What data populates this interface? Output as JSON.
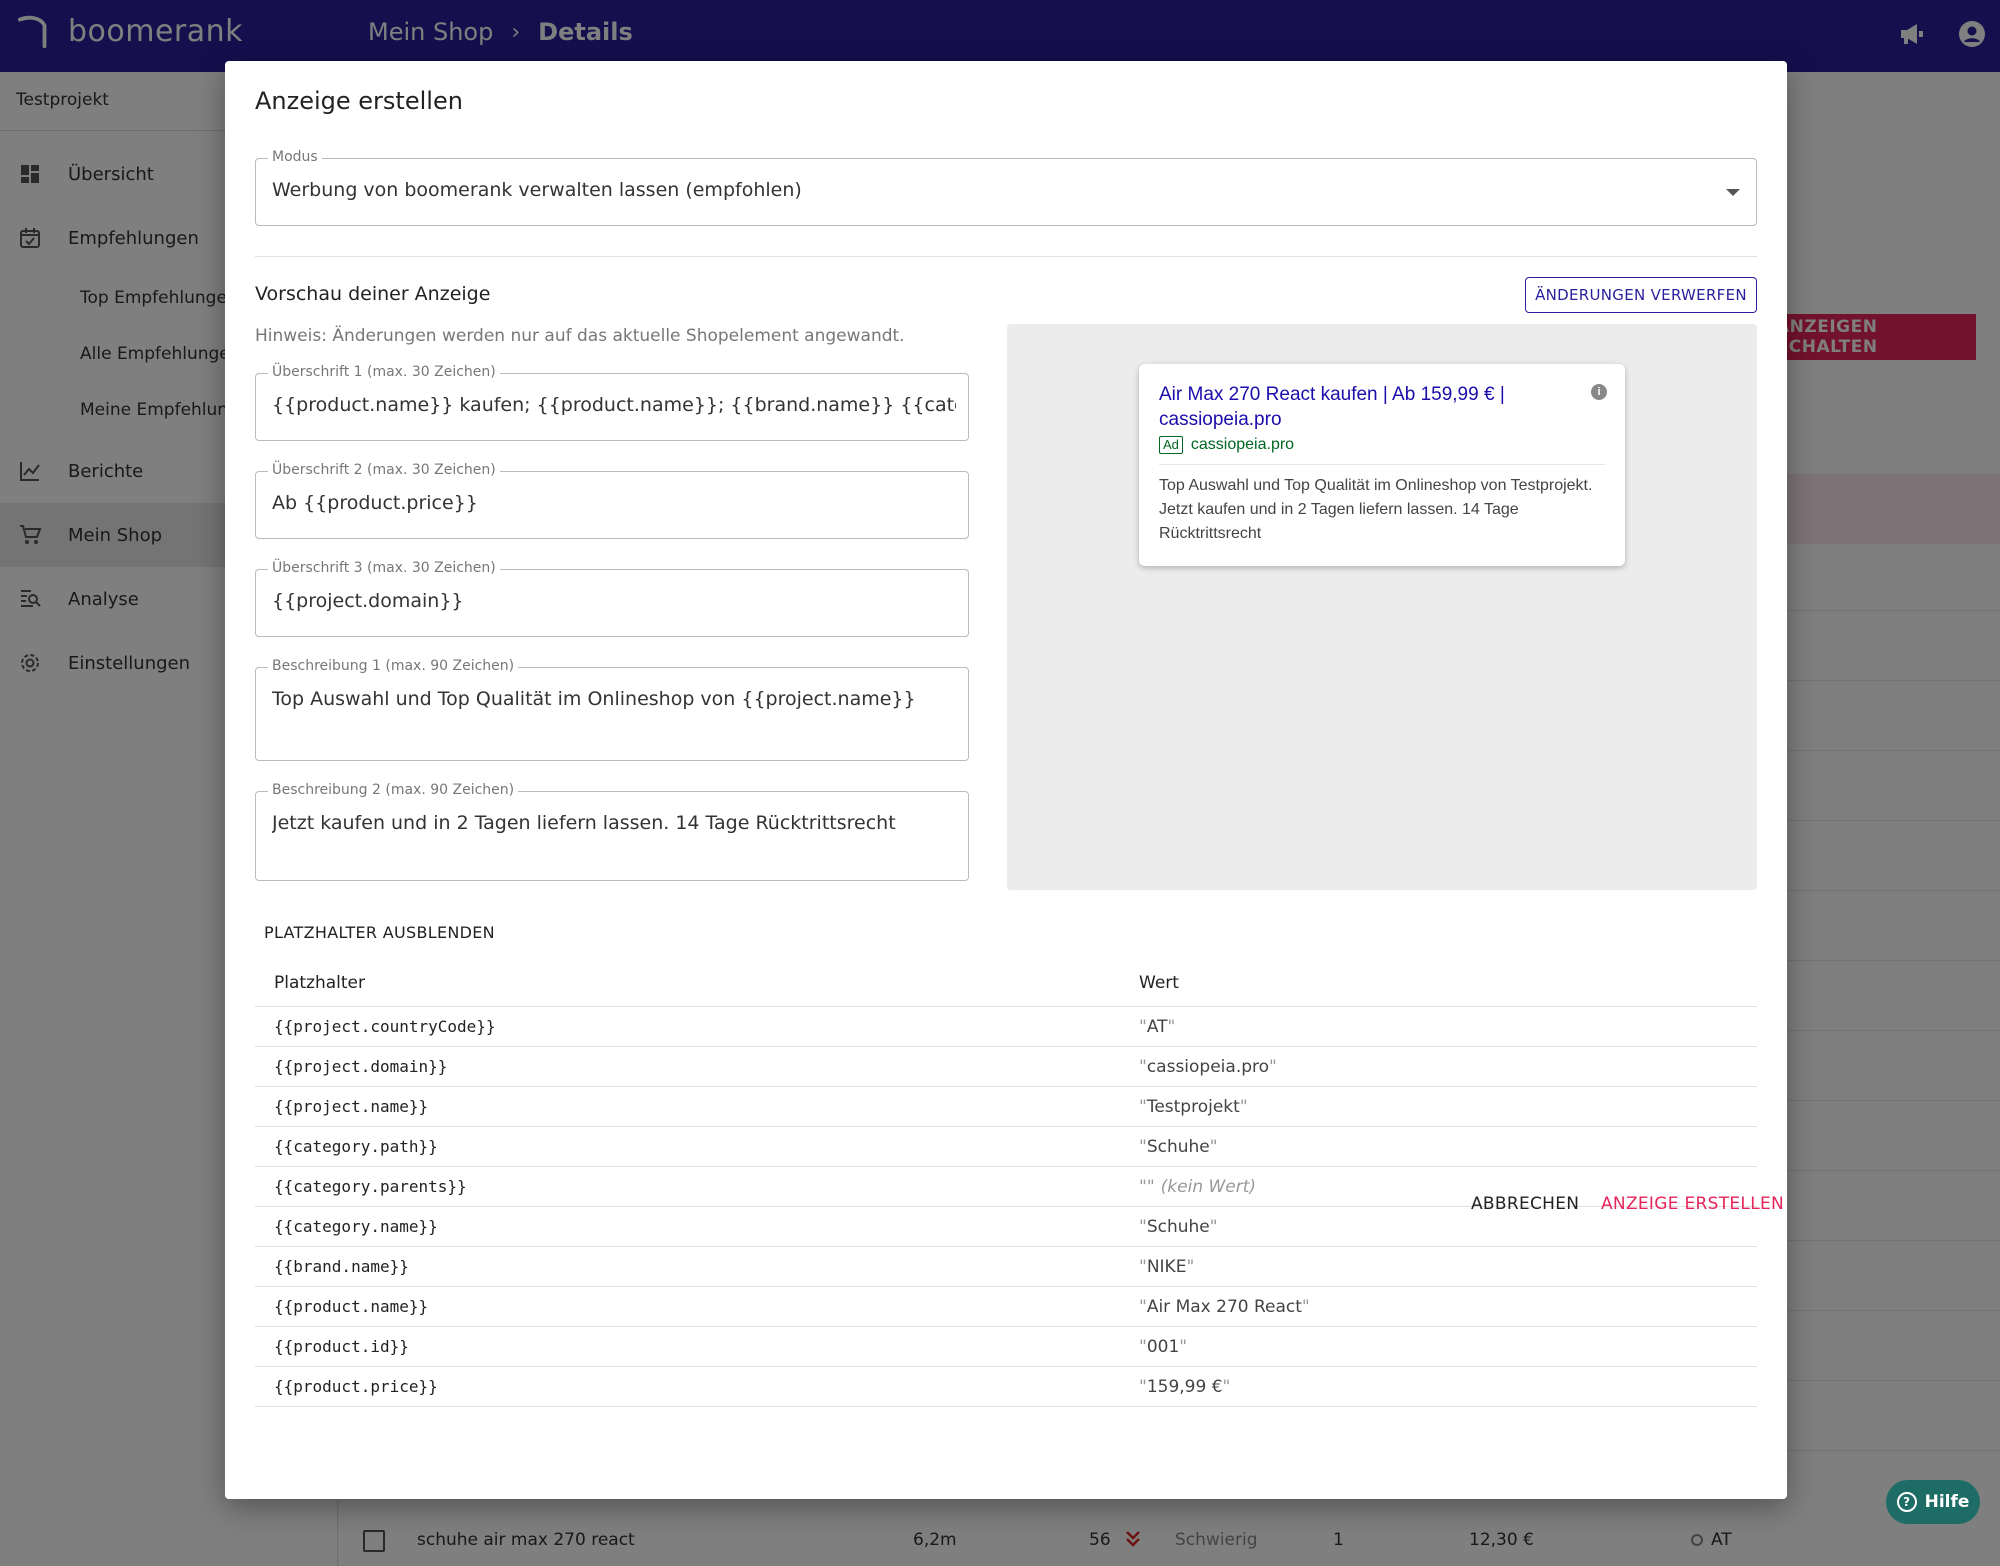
{
  "app": {
    "logo_text": "boomerank"
  },
  "breadcrumb": {
    "parent": "Mein Shop",
    "separator": "›",
    "current": "Details"
  },
  "sidebar": {
    "project": "Testprojekt",
    "items": [
      {
        "label": "Übersicht",
        "icon": "dashboard-icon"
      },
      {
        "label": "Empfehlungen",
        "icon": "calendar-check-icon"
      },
      {
        "label": "Berichte",
        "icon": "chart-line-icon"
      },
      {
        "label": "Mein Shop",
        "icon": "cart-icon"
      },
      {
        "label": "Analyse",
        "icon": "analyse-icon"
      },
      {
        "label": "Einstellungen",
        "icon": "gear-icon"
      }
    ],
    "subitems": [
      "Top Empfehlungen",
      "Alle Empfehlungen",
      "Meine Empfehlungen"
    ]
  },
  "background": {
    "cta": "ANZEIGEN SCHALTEN",
    "row": {
      "keyword": "schuhe air max 270 react",
      "volume": "6,2m",
      "position": "56",
      "difficulty": "Schwierig",
      "count": "1",
      "cpc": "12,30 €",
      "country": "AT"
    }
  },
  "help": {
    "label": "Hilfe"
  },
  "dialog": {
    "title": "Anzeige erstellen",
    "mode": {
      "label": "Modus",
      "value": "Werbung von boomerank verwalten lassen (empfohlen)"
    },
    "preview_title": "Vorschau deiner Anzeige",
    "discard_label": "ÄNDERUNGEN VERWERFEN",
    "hint": "Hinweis: Änderungen werden nur auf das aktuelle Shopelement angewandt.",
    "fields": {
      "h1": {
        "label": "Überschrift 1 (max. 30 Zeichen)",
        "value": "{{product.name}} kaufen; {{product.name}}; {{brand.name}} {{category.name}}"
      },
      "h2": {
        "label": "Überschrift 2 (max. 30 Zeichen)",
        "value": "Ab {{product.price}}"
      },
      "h3": {
        "label": "Überschrift 3 (max. 30 Zeichen)",
        "value": "{{project.domain}}"
      },
      "d1": {
        "label": "Beschreibung 1 (max. 90 Zeichen)",
        "value": "Top Auswahl und Top Qualität im Onlineshop von {{project.name}}"
      },
      "d2": {
        "label": "Beschreibung 2 (max. 90 Zeichen)",
        "value": "Jetzt kaufen und in 2 Tagen liefern lassen. 14 Tage Rücktrittsrecht"
      }
    },
    "ad_preview": {
      "headline": "Air Max 270 React kaufen | Ab 159,99 € | cassiopeia.pro",
      "badge": "Ad",
      "url": "cassiopeia.pro",
      "description": "Top Auswahl und Top Qualität im Onlineshop von Testprojekt. Jetzt kaufen und in 2 Tagen liefern lassen. 14 Tage Rücktrittsrecht",
      "info": "i"
    },
    "placeholder_toggle": "PLATZHALTER AUSBLENDEN",
    "table": {
      "col_key": "Platzhalter",
      "col_value": "Wert",
      "empty_note": "(kein Wert)",
      "rows": [
        {
          "key": "{{project.countryCode}}",
          "value": "AT"
        },
        {
          "key": "{{project.domain}}",
          "value": "cassiopeia.pro"
        },
        {
          "key": "{{project.name}}",
          "value": "Testprojekt"
        },
        {
          "key": "{{category.path}}",
          "value": "Schuhe"
        },
        {
          "key": "{{category.parents}}",
          "value": ""
        },
        {
          "key": "{{category.name}}",
          "value": "Schuhe"
        },
        {
          "key": "{{brand.name}}",
          "value": "NIKE"
        },
        {
          "key": "{{product.name}}",
          "value": "Air Max 270 React"
        },
        {
          "key": "{{product.id}}",
          "value": "001"
        },
        {
          "key": "{{product.price}}",
          "value": "159,99 €"
        }
      ]
    },
    "cancel_label": "ABBRECHEN",
    "create_label": "ANZEIGE ERSTELLEN"
  },
  "colors": {
    "brand": "#2a1f9c",
    "accent": "#e6245a",
    "help": "#1d6c66",
    "ad_link": "#1a0dab",
    "ad_url": "#006621"
  }
}
